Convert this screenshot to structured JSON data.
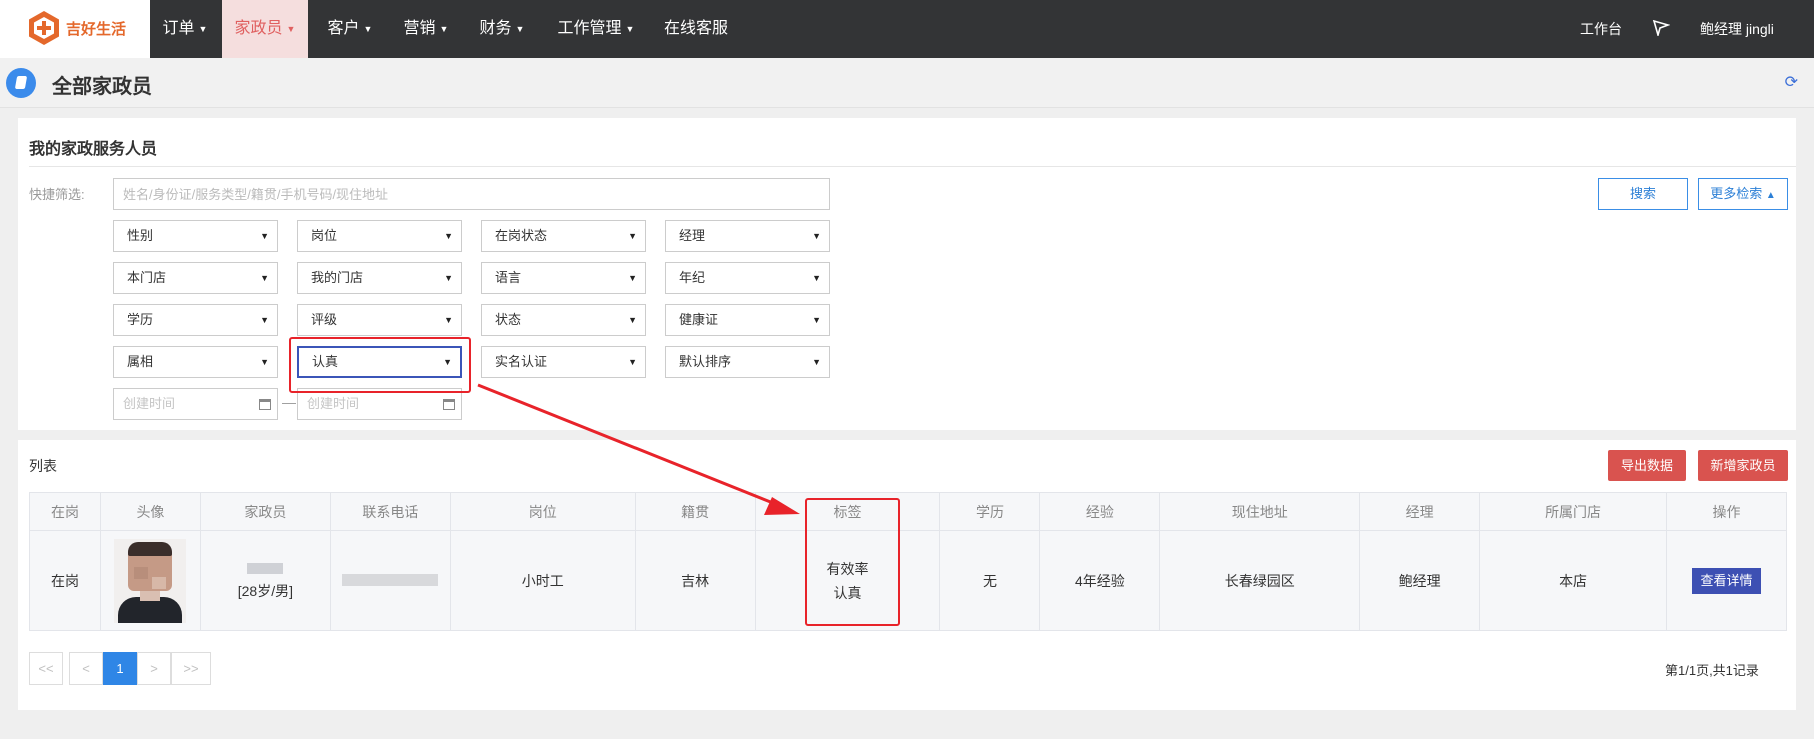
{
  "brand": {
    "name": "吉好生活"
  },
  "nav": [
    {
      "label": "订单",
      "has_dropdown": true
    },
    {
      "label": "家政员",
      "has_dropdown": true,
      "active": true
    },
    {
      "label": "客户",
      "has_dropdown": true
    },
    {
      "label": "营销",
      "has_dropdown": true
    },
    {
      "label": "财务",
      "has_dropdown": true
    },
    {
      "label": "工作管理",
      "has_dropdown": true
    },
    {
      "label": "在线客服",
      "has_dropdown": false
    }
  ],
  "top_right": {
    "workbench": "工作台",
    "flag_icon": "send-flag-icon",
    "user": "鲍经理 jingli"
  },
  "page": {
    "title": "全部家政员",
    "title_icon": "book-icon",
    "refresh_icon": "refresh-icon"
  },
  "filter": {
    "section_title": "我的家政服务人员",
    "quick_label": "快捷筛选:",
    "search_placeholder": "姓名/身份证/服务类型/籍贯/手机号码/现住地址",
    "search_button": "搜索",
    "more_button": "更多检索",
    "selects": [
      [
        "性别",
        "岗位",
        "在岗状态",
        "经理"
      ],
      [
        "本门店",
        "我的门店",
        "语言",
        "年纪"
      ],
      [
        "学历",
        "评级",
        "状态",
        "健康证"
      ],
      [
        "属相",
        "认真",
        "实名认证",
        "默认排序"
      ]
    ],
    "focused_select": "认真",
    "date_start_placeholder": "创建时间",
    "date_end_placeholder": "创建时间",
    "date_separator": "—"
  },
  "list": {
    "title": "列表",
    "export_button": "导出数据",
    "add_button": "新增家政员",
    "columns": [
      "在岗",
      "头像",
      "家政员",
      "联系电话",
      "岗位",
      "籍贯",
      "标签",
      "学历",
      "经验",
      "现住地址",
      "经理",
      "所属门店",
      "操作"
    ],
    "rows": [
      {
        "status": "在岗",
        "age_gender": "[28岁/男]",
        "position": "小时工",
        "hometown": "吉林",
        "tags": [
          "有效率",
          "认真"
        ],
        "education": "无",
        "experience": "4年经验",
        "address": "长春绿园区",
        "manager": "鲍经理",
        "store": "本店",
        "action": "查看详情"
      }
    ]
  },
  "pagination": {
    "first": "<<",
    "prev": "<",
    "current": "1",
    "next": ">",
    "last": ">>",
    "info": "第1/1页,共1记录"
  },
  "colors": {
    "topbar": "#333436",
    "active_nav_bg": "#f5dede",
    "accent_blue": "#2f86e6",
    "danger": "#d9534f",
    "annotation": "#e8232a",
    "status_green": "#2fae6a"
  }
}
